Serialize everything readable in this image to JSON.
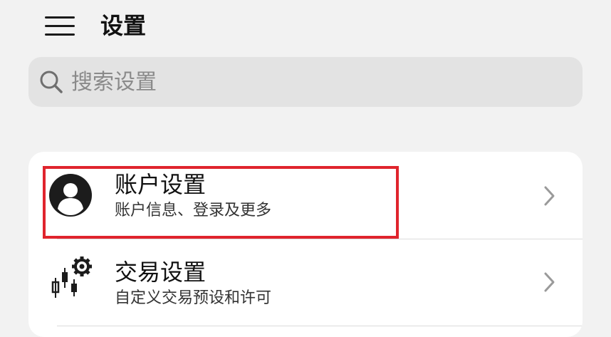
{
  "header": {
    "title": "设置",
    "menu_icon": "hamburger-menu-icon"
  },
  "search": {
    "placeholder": "搜索设置",
    "value": "",
    "icon": "search-icon"
  },
  "settings": {
    "items": [
      {
        "title": "账户设置",
        "subtitle": "账户信息、登录及更多",
        "icon": "account-avatar-icon"
      },
      {
        "title": "交易设置",
        "subtitle": "自定义交易预设和许可",
        "icon": "trading-gear-icon"
      }
    ]
  },
  "colors": {
    "background": "#f2f2f2",
    "card": "#ffffff",
    "search_bg": "#e3e3e3",
    "highlight": "#e0242d",
    "chevron": "#9a9a9a"
  }
}
